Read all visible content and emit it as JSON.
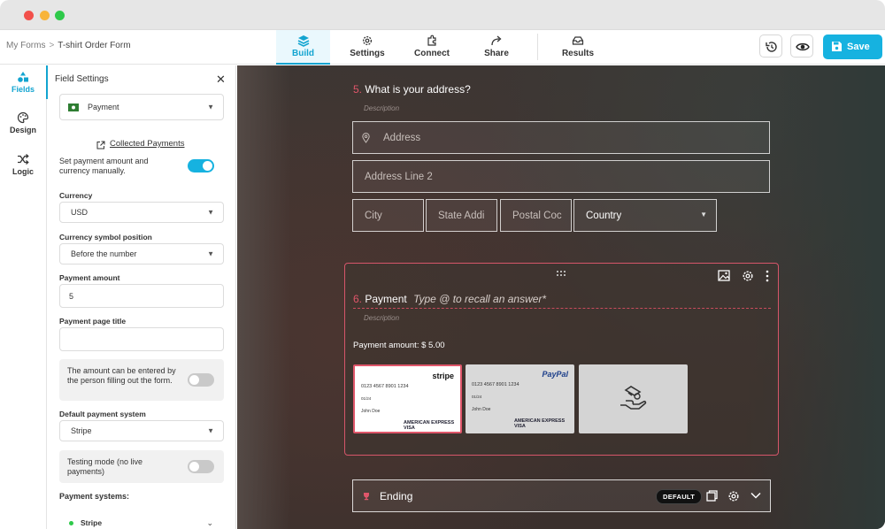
{
  "breadcrumb": {
    "root": "My Forms",
    "separator": ">",
    "current": "T-shirt Order Form"
  },
  "nav": {
    "tabs": [
      {
        "label": "Build",
        "icon": "layers-icon",
        "active": true
      },
      {
        "label": "Settings",
        "icon": "gear-icon",
        "active": false
      },
      {
        "label": "Connect",
        "icon": "puzzle-icon",
        "active": false
      },
      {
        "label": "Share",
        "icon": "share-arrow-icon",
        "active": false
      },
      {
        "label": "Results",
        "icon": "inbox-icon",
        "active": false
      }
    ],
    "save_label": "Save",
    "accent": "#16b2e0"
  },
  "rail": {
    "items": [
      {
        "label": "Fields",
        "icon": "shapes-icon",
        "active": true
      },
      {
        "label": "Design",
        "icon": "palette-icon",
        "active": false
      },
      {
        "label": "Logic",
        "icon": "shuffle-icon",
        "active": false
      }
    ]
  },
  "panel": {
    "title": "Field Settings",
    "field_type": "Payment",
    "collected_link": "Collected Payments",
    "manual_amount_label": "Set payment amount and currency manually.",
    "manual_amount_on": true,
    "currency_label": "Currency",
    "currency_value": "USD",
    "symbol_position_label": "Currency symbol position",
    "symbol_position_value": "Before the number",
    "amount_label": "Payment amount",
    "amount_value": "5",
    "page_title_label": "Payment page title",
    "page_title_value": "",
    "user_amount_label": "The amount can be entered by the person filling out the form.",
    "user_amount_on": false,
    "default_system_label": "Default payment system",
    "default_system_value": "Stripe",
    "testing_label": "Testing mode (no live payments)",
    "testing_on": false,
    "systems_label": "Payment systems:",
    "systems": [
      {
        "name": "Stripe",
        "status_color": "#2ec94a"
      }
    ]
  },
  "canvas": {
    "q5": {
      "number": "5.",
      "title": "What is your address?",
      "description": "Description",
      "placeholders": {
        "address": "Address",
        "line2": "Address Line 2",
        "city": "City",
        "state": "State Addi",
        "postal": "Postal Coc",
        "country": "Country"
      }
    },
    "q6": {
      "number": "6.",
      "title": "Payment",
      "hint": "Type @ to recall an answer*",
      "description": "Description",
      "amount_text": "Payment amount: $ 5.00",
      "cards": [
        {
          "brand": "stripe",
          "number": "0123 4567 8901 1234",
          "holder": "John Doe",
          "expiry": "01/24",
          "logos": "AMERICAN EXPRESS   VISA"
        },
        {
          "brand": "PayPal",
          "number": "0123 4567 8901 1234",
          "holder": "John Doe",
          "expiry": "01/24",
          "logos": "AMERICAN EXPRESS   VISA"
        },
        {
          "brand": "",
          "icon": "hand-coins-icon"
        }
      ]
    },
    "ending": {
      "title": "Ending",
      "badge": "DEFAULT"
    }
  }
}
